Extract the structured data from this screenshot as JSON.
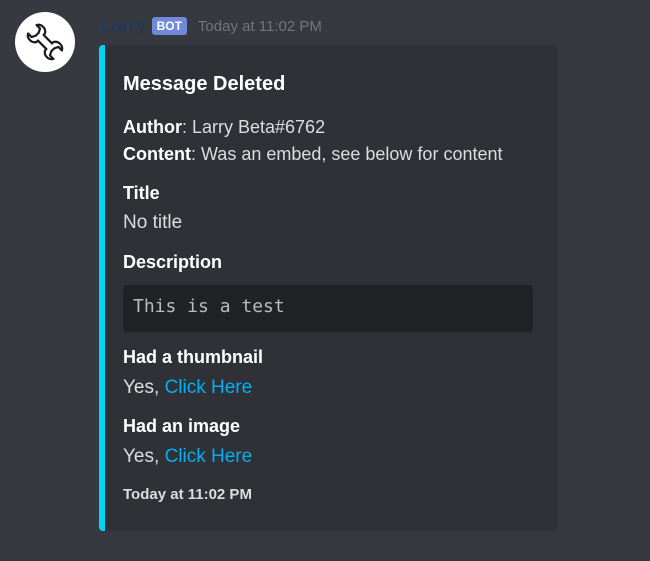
{
  "message": {
    "author": "Larry",
    "bot_tag": "BOT",
    "timestamp": "Today at 11:02 PM"
  },
  "embed": {
    "accent_color": "#00d4f5",
    "title": "Message Deleted",
    "author_key": "Author",
    "author_value": ": Larry Beta#6762",
    "content_key": "Content",
    "content_value": ": Was an embed, see below for content",
    "fields": {
      "title_name": "Title",
      "title_value": "No title",
      "description_name": "Description",
      "description_code": "This is a test",
      "thumbnail_name": "Had a thumbnail",
      "thumbnail_prefix": "Yes, ",
      "thumbnail_link": "Click Here",
      "image_name": "Had an image",
      "image_prefix": "Yes, ",
      "image_link": "Click Here"
    },
    "footer": "Today at 11:02 PM"
  },
  "icons": {
    "avatar": "wrench-icon"
  }
}
